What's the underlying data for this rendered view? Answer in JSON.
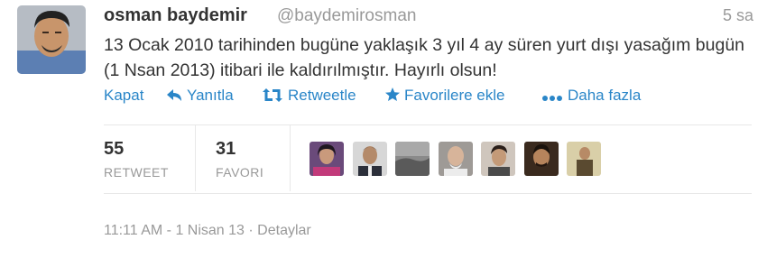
{
  "tweet": {
    "fullname": "osman baydemir",
    "screen_name": "@baydemirosman",
    "time_ago": "5 sa",
    "text": "13 Ocak 2010 tarihinden bugüne yaklaşık  3 yıl 4 ay süren yurt dışı yasağım bugün (1 Nsan 2013) itibari ile kaldırılmıştır. Hayırlı olsun!"
  },
  "actions": {
    "close": "Kapat",
    "reply": "Yanıtla",
    "retweet": "Retweetle",
    "favorite": "Favorilere ekle",
    "more": "Daha fazla"
  },
  "stats": {
    "retweets": "55",
    "retweets_label": "RETWEET",
    "favorites": "31",
    "favorites_label": "FAVORI"
  },
  "meta": {
    "timestamp": "11:11 AM - 1 Nisan 13",
    "separator": "·",
    "details": "Detaylar"
  },
  "colors": {
    "link": "#2a86c8",
    "muted": "#999999",
    "text": "#333333"
  },
  "icons": [
    "reply-icon",
    "retweet-icon",
    "star-icon",
    "ellipsis-icon"
  ]
}
